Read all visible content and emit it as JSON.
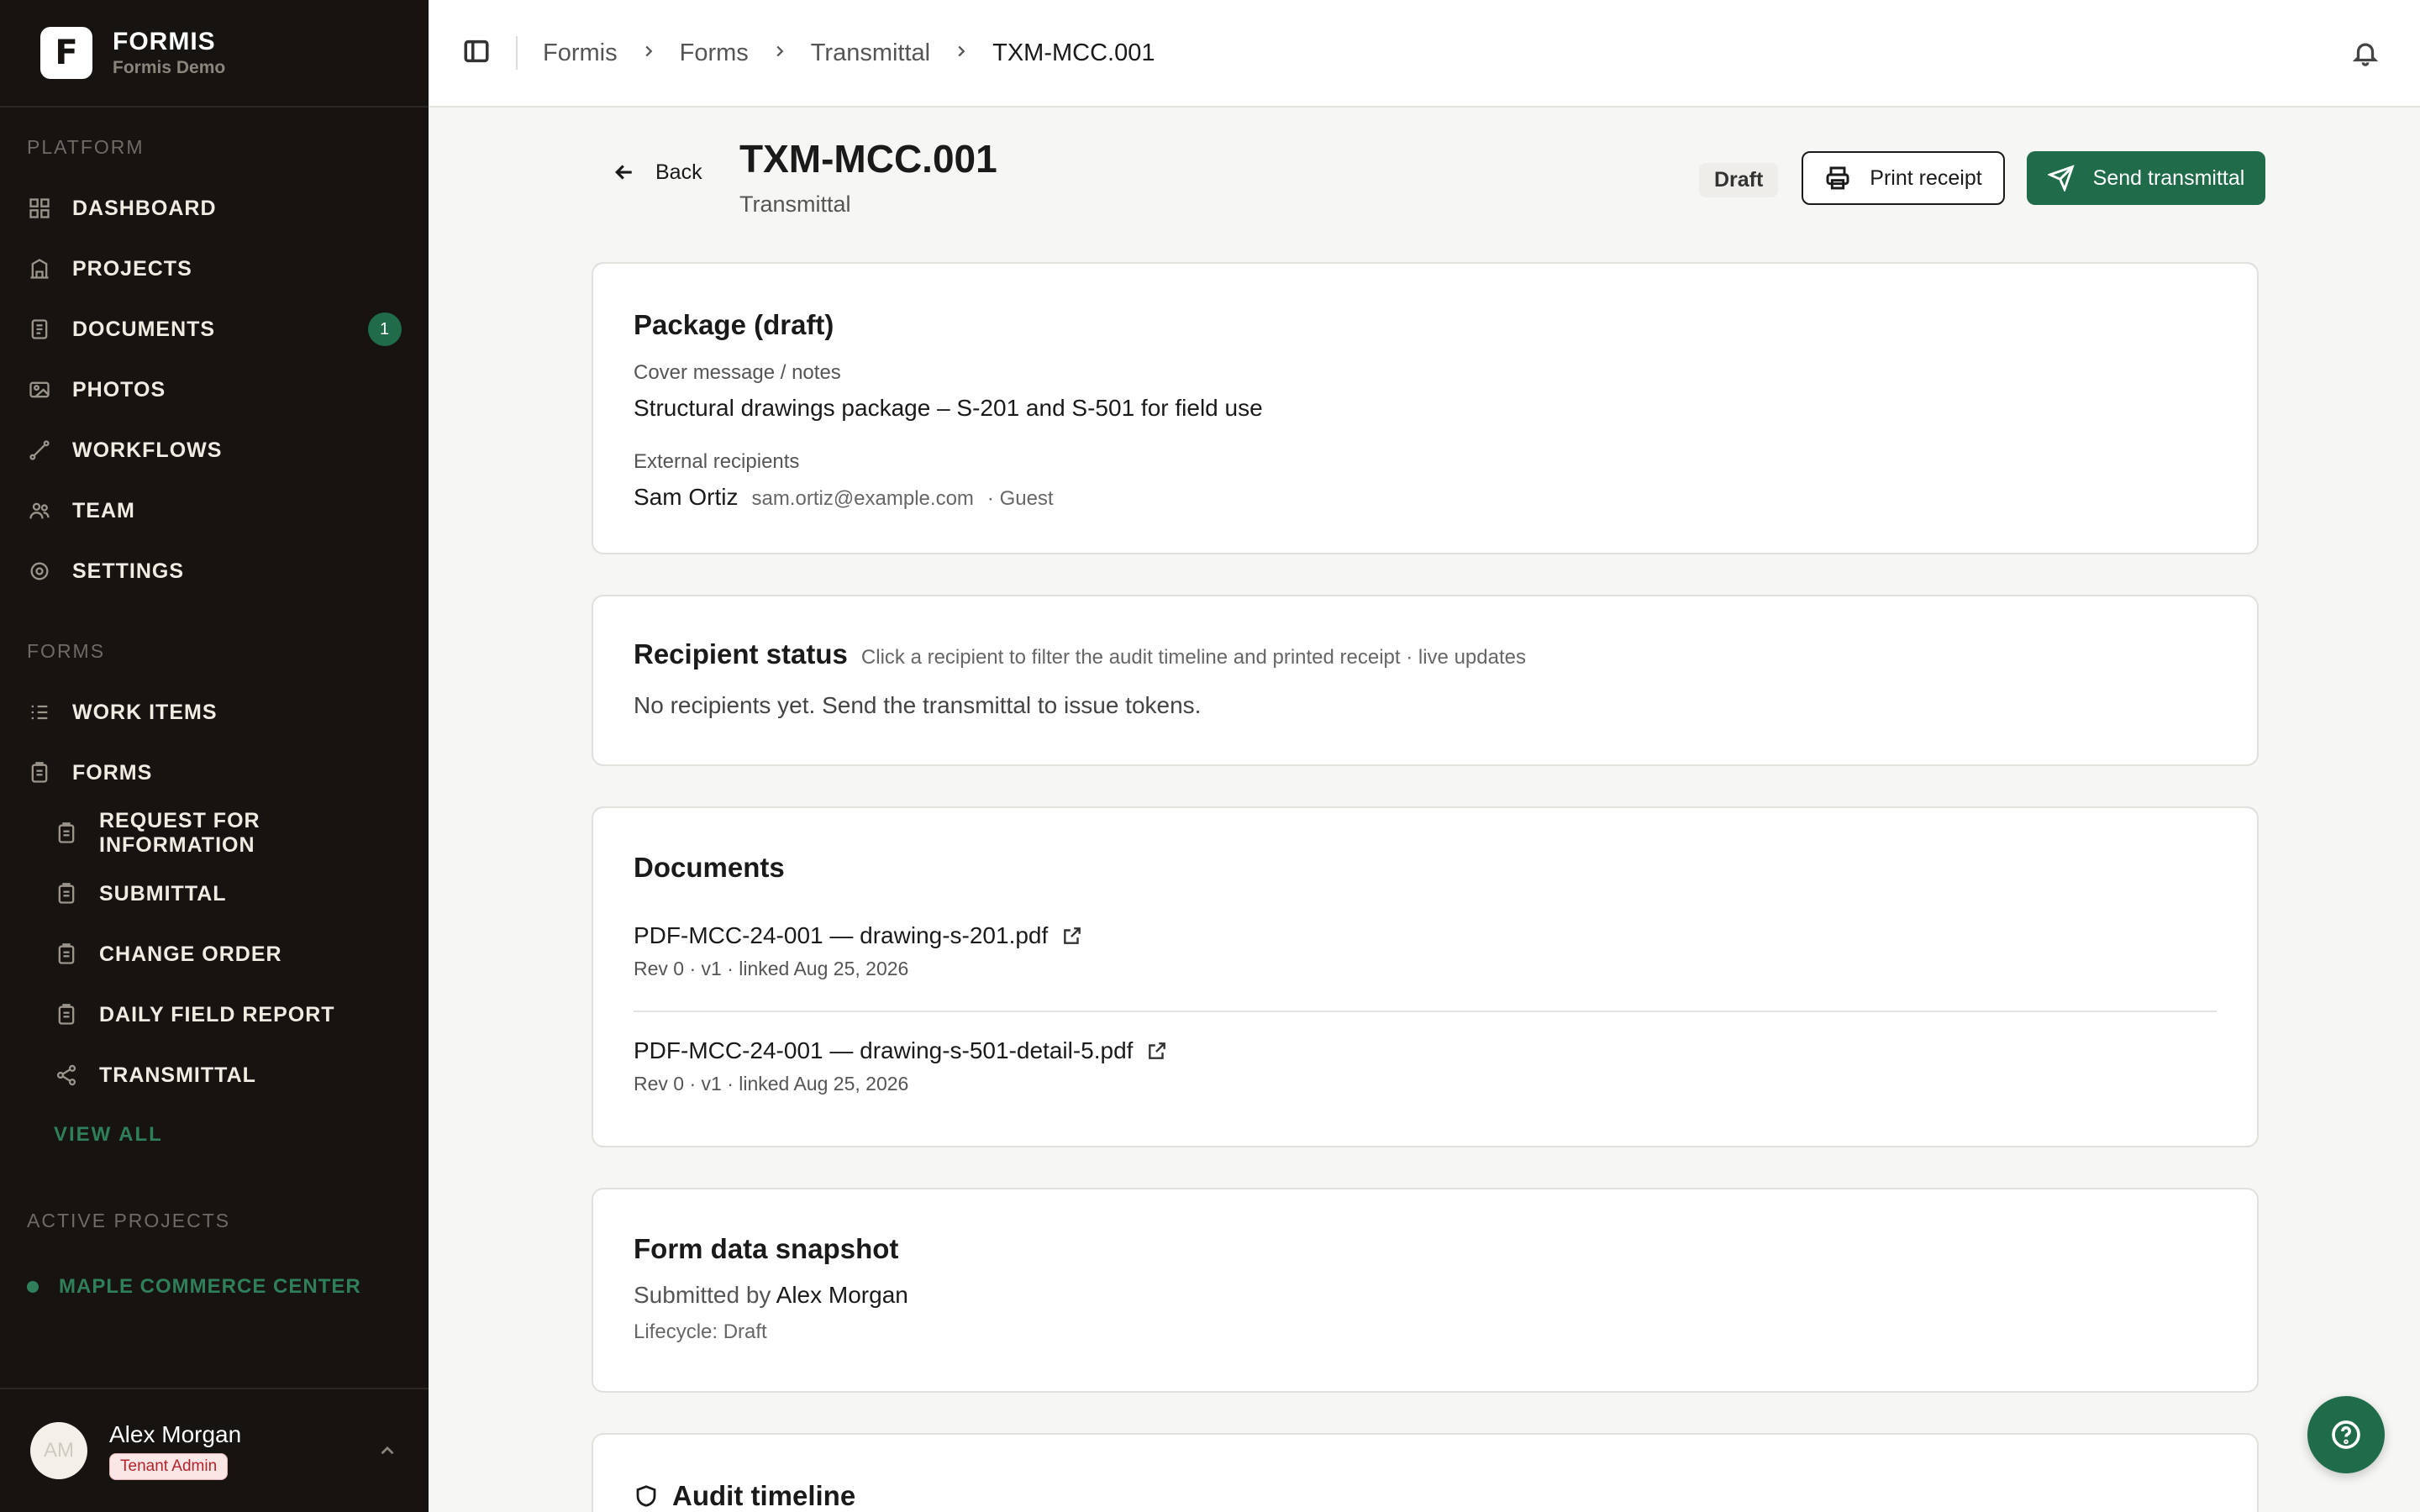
{
  "brand": {
    "name": "FORMIS",
    "sub": "Formis Demo",
    "logo_letter": "F"
  },
  "sidebar": {
    "platform_label": "PLATFORM",
    "platform_items": [
      {
        "label": "DASHBOARD",
        "icon": "grid-icon"
      },
      {
        "label": "PROJECTS",
        "icon": "building-icon"
      },
      {
        "label": "DOCUMENTS",
        "icon": "documents-icon",
        "badge": "1"
      },
      {
        "label": "PHOTOS",
        "icon": "photos-icon"
      },
      {
        "label": "WORKFLOWS",
        "icon": "workflow-icon"
      },
      {
        "label": "TEAM",
        "icon": "team-icon"
      },
      {
        "label": "SETTINGS",
        "icon": "gear-icon"
      }
    ],
    "forms_label": "FORMS",
    "forms_items": [
      {
        "label": "WORK ITEMS",
        "icon": "list-icon"
      },
      {
        "label": "FORMS",
        "icon": "clipboard-icon"
      }
    ],
    "forms_sub_items": [
      {
        "label": "REQUEST FOR INFORMATION",
        "icon": "clipboard-icon"
      },
      {
        "label": "SUBMITTAL",
        "icon": "clipboard-icon"
      },
      {
        "label": "CHANGE ORDER",
        "icon": "clipboard-icon"
      },
      {
        "label": "DAILY FIELD REPORT",
        "icon": "clipboard-icon"
      },
      {
        "label": "TRANSMITTAL",
        "icon": "share-icon"
      }
    ],
    "view_all": "VIEW ALL",
    "active_projects_label": "ACTIVE PROJECTS",
    "active_projects": [
      {
        "label": "MAPLE COMMERCE CENTER"
      }
    ]
  },
  "user": {
    "name": "Alex Morgan",
    "initials": "AM",
    "role": "Tenant Admin"
  },
  "breadcrumb": [
    "Formis",
    "Forms",
    "Transmittal",
    "TXM-MCC.001"
  ],
  "header": {
    "back_label": "Back",
    "title": "TXM-MCC.001",
    "subtitle": "Transmittal",
    "status": "Draft",
    "print_label": "Print receipt",
    "send_label": "Send transmittal"
  },
  "package": {
    "title": "Package (draft)",
    "cover_label": "Cover message / notes",
    "cover_value": "Structural drawings package – S-201 and S-501 for field use",
    "recipients_label": "External recipients",
    "recipient_name": "Sam Ortiz",
    "recipient_email": "sam.ortiz@example.com",
    "recipient_type": "· Guest"
  },
  "recipient_status": {
    "title": "Recipient status",
    "hint": "Click a recipient to filter the audit timeline and printed receipt · live updates",
    "empty": "No recipients yet. Send the transmittal to issue tokens."
  },
  "documents": {
    "title": "Documents",
    "items": [
      {
        "name": "PDF-MCC-24-001 — drawing-s-201.pdf",
        "meta": "Rev 0 · v1 · linked Aug 25, 2026"
      },
      {
        "name": "PDF-MCC-24-001 — drawing-s-501-detail-5.pdf",
        "meta": "Rev 0 · v1 · linked Aug 25, 2026"
      }
    ]
  },
  "snapshot": {
    "title": "Form data snapshot",
    "submitted_prefix": "Submitted by",
    "submitted_by": "Alex Morgan",
    "lifecycle": "Lifecycle: Draft"
  },
  "audit": {
    "title": "Audit timeline"
  },
  "colors": {
    "accent": "#1f6b4a",
    "sidebar_bg": "#161310",
    "badge_role": "#b3262d"
  }
}
